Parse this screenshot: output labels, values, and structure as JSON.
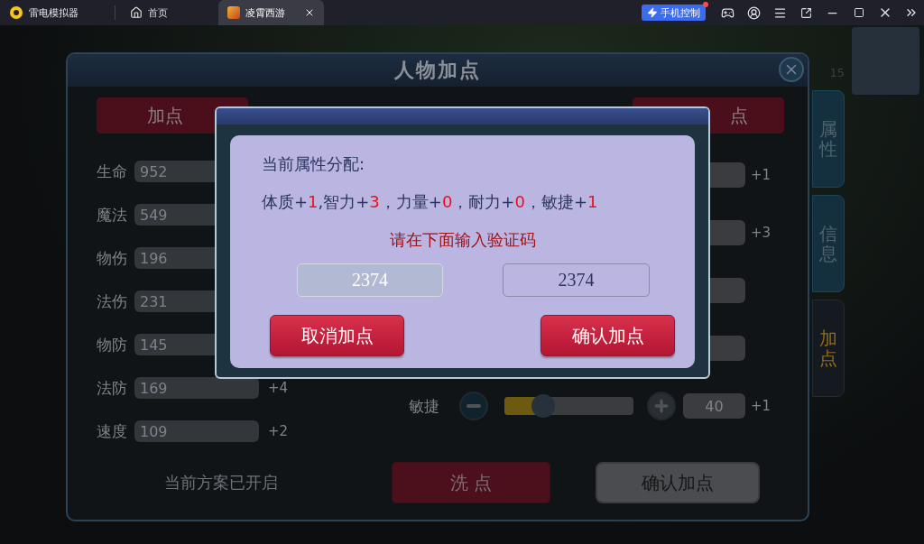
{
  "emulator": {
    "app_name": "雷电模拟器",
    "tabs": [
      {
        "label": "首页",
        "selected": false,
        "closable": false
      },
      {
        "label": "凌霄西游",
        "selected": true,
        "closable": true
      }
    ],
    "phone_control": "手机控制",
    "phone_control_alert": true
  },
  "side_level": "15",
  "panel": {
    "title": "人物加点",
    "left_button": "加点",
    "right_button": "点",
    "stats": [
      {
        "label": "生命",
        "value": "952"
      },
      {
        "label": "魔法",
        "value": "549"
      },
      {
        "label": "物伤",
        "value": "196"
      },
      {
        "label": "法伤",
        "value": "231"
      },
      {
        "label": "物防",
        "value": "145"
      },
      {
        "label": "法防",
        "value": "169",
        "bonus": "+4"
      },
      {
        "label": "速度",
        "value": "109",
        "bonus": "+2"
      }
    ],
    "attributes": [
      {
        "kind": "box",
        "bonus": "+1"
      },
      {
        "kind": "box",
        "bonus": "+3"
      },
      {
        "kind": "box"
      },
      {
        "kind": "box"
      },
      {
        "kind": "slider",
        "label": "敏捷",
        "value": "40",
        "bonus": "+1",
        "level": 0.3
      }
    ],
    "scheme_status": "当前方案已开启",
    "reset_button": "洗 点",
    "confirm_button": "确认加点",
    "side_tabs": [
      {
        "label": "属性",
        "selected": false
      },
      {
        "label": "信息",
        "selected": false
      },
      {
        "label": "加点",
        "selected": true
      }
    ]
  },
  "dialog": {
    "heading": "当前属性分配:",
    "allocation": [
      {
        "text": "体质+",
        "value": "1"
      },
      {
        "text": ",智力+",
        "value": "3"
      },
      {
        "text": "，力量+",
        "value": "0"
      },
      {
        "text": "，耐力+",
        "value": "0"
      },
      {
        "text": "，敏捷+",
        "value": "1"
      }
    ],
    "prompt": "请在下面输入验证码",
    "captcha": "2374",
    "input_value": "2374",
    "cancel_button": "取消加点",
    "confirm_button": "确认加点"
  }
}
